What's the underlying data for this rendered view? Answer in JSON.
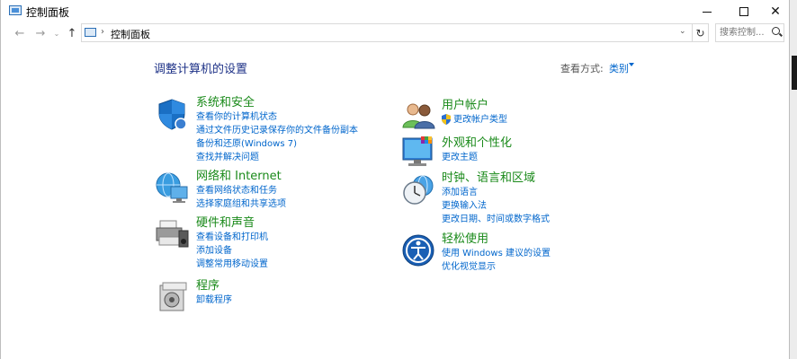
{
  "window": {
    "title": "控制面板",
    "controls": {
      "minimize": "—",
      "maximize": "",
      "close": "✕"
    }
  },
  "nav": {
    "back": "←",
    "forward": "→",
    "recent": "⌄",
    "up": "↑",
    "address_separator": "›",
    "breadcrumb": "控制面板",
    "address_dropdown": "⌄",
    "refresh": "↻",
    "search_placeholder": "搜索控制..."
  },
  "content": {
    "heading": "调整计算机的设置",
    "view_by_label": "查看方式:",
    "view_by_value": "类别"
  },
  "categories_left": [
    {
      "title": "系统和安全",
      "icon": "shield-icon",
      "links": [
        "查看你的计算机状态",
        "通过文件历史记录保存你的文件备份副本",
        "备份和还原(Windows 7)",
        "查找并解决问题"
      ]
    },
    {
      "title": "网络和 Internet",
      "icon": "network-globe-icon",
      "links": [
        "查看网络状态和任务",
        "选择家庭组和共享选项"
      ]
    },
    {
      "title": "硬件和声音",
      "icon": "printer-speaker-icon",
      "links": [
        "查看设备和打印机",
        "添加设备",
        "调整常用移动设置"
      ]
    },
    {
      "title": "程序",
      "icon": "programs-icon",
      "links": [
        "卸载程序"
      ]
    }
  ],
  "categories_right": [
    {
      "title": "用户帐户",
      "icon": "users-icon",
      "links": [
        "更改帐户类型"
      ]
    },
    {
      "title": "外观和个性化",
      "icon": "monitor-palette-icon",
      "links": [
        "更改主题"
      ]
    },
    {
      "title": "时钟、语言和区域",
      "icon": "clock-globe-icon",
      "links": [
        "添加语言",
        "更换输入法",
        "更改日期、时间或数字格式"
      ]
    },
    {
      "title": "轻松使用",
      "icon": "ease-of-access-icon",
      "links": [
        "使用 Windows 建议的设置",
        "优化视觉显示"
      ]
    }
  ],
  "colors": {
    "category_title": "#1a8a1a",
    "link": "#0066cc",
    "heading": "#1e3287"
  }
}
